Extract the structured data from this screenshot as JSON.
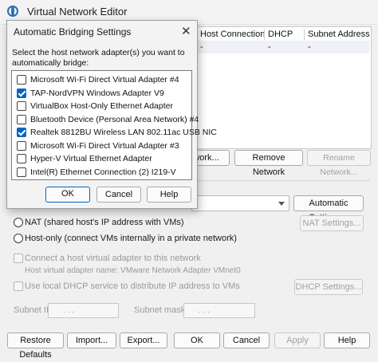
{
  "window": {
    "title": "Virtual Network Editor",
    "table_headers": [
      "Host Connection",
      "DHCP",
      "Subnet Address"
    ],
    "table_row": [
      "-",
      "-",
      "-"
    ]
  },
  "buttons": {
    "add_network": "twork...",
    "remove_network": "Remove Network",
    "rename_network": "Rename Network...",
    "automatic_settings": "Automatic Settings...",
    "nat_settings": "NAT Settings...",
    "dhcp_settings": "DHCP Settings...",
    "restore_defaults": "Restore Defaults",
    "import": "Import...",
    "export": "Export...",
    "ok": "OK",
    "cancel": "Cancel",
    "apply": "Apply",
    "help": "Help"
  },
  "options": {
    "nat": "NAT (shared host's IP address with VMs)",
    "host_only": "Host-only (connect VMs internally in a private network)",
    "connect_adapter": "Connect a host virtual adapter to this network",
    "adapter_name": "Host virtual adapter name: VMware Network Adapter VMnet0",
    "use_dhcp": "Use local DHCP service to distribute IP address to VMs",
    "subnet_ip_label": "Subnet IP:",
    "subnet_mask_label": "Subnet mask:",
    "ip_placeholder": ".   .   .",
    "mask_placeholder": ".   .   ."
  },
  "dialog": {
    "title": "Automatic Bridging Settings",
    "prompt": "Select the host network adapter(s) you want to automatically bridge:",
    "adapters": [
      {
        "label": "Microsoft Wi-Fi Direct Virtual Adapter #4",
        "checked": false
      },
      {
        "label": "TAP-NordVPN Windows Adapter V9",
        "checked": true
      },
      {
        "label": "VirtualBox Host-Only Ethernet Adapter",
        "checked": false
      },
      {
        "label": "Bluetooth Device (Personal Area Network) #4",
        "checked": false
      },
      {
        "label": "Realtek 8812BU Wireless LAN 802.11ac USB NIC",
        "checked": true
      },
      {
        "label": "Microsoft Wi-Fi Direct Virtual Adapter #3",
        "checked": false
      },
      {
        "label": "Hyper-V Virtual Ethernet Adapter",
        "checked": false
      },
      {
        "label": "Intel(R) Ethernet Connection (2) I219-V",
        "checked": false
      }
    ],
    "ok": "OK",
    "cancel": "Cancel",
    "help": "Help"
  }
}
